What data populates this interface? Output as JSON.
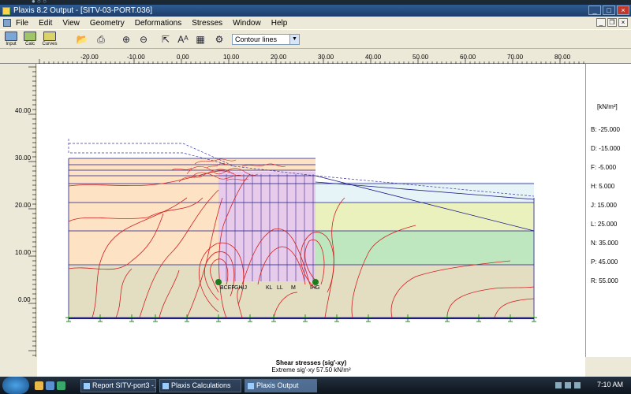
{
  "window": {
    "title": "Plaxis 8.2 Output - [SITV-03-PORT.036]"
  },
  "menu": [
    "File",
    "Edit",
    "View",
    "Geometry",
    "Deformations",
    "Stresses",
    "Window",
    "Help"
  ],
  "toolbar": {
    "input_label": "Input",
    "calc_label": "Calc",
    "curves_label": "Curves",
    "view_mode": "Contour lines"
  },
  "ruler": {
    "x_ticks": [
      "-20.00",
      "-10.00",
      "0.00",
      "10.00",
      "20.00",
      "30.00",
      "40.00",
      "50.00",
      "60.00",
      "70.00",
      "80.00"
    ],
    "y_ticks": [
      "40.00",
      "30.00",
      "20.00",
      "10.00",
      "0.00"
    ]
  },
  "legend": {
    "unit": "[kN/m²]",
    "entries": [
      {
        "key": "B",
        "value": "-25.000"
      },
      {
        "key": "D",
        "value": "-15.000"
      },
      {
        "key": "F",
        "value": "-5.000"
      },
      {
        "key": "H",
        "value": "5.000"
      },
      {
        "key": "J",
        "value": "15.000"
      },
      {
        "key": "L",
        "value": "25.000"
      },
      {
        "key": "N",
        "value": "35.000"
      },
      {
        "key": "P",
        "value": "45.000"
      },
      {
        "key": "R",
        "value": "55.000"
      }
    ]
  },
  "contour_labels": [
    "BCEF",
    "GHIJ",
    "KL",
    "LL",
    "M",
    "IHG"
  ],
  "caption": {
    "title": "Shear stresses (sig'-xy)",
    "subtitle": "Extreme sig'-xy 57.50 kN/m²"
  },
  "taskbar": {
    "tasks": [
      "Report SITV-port3 -...",
      "Plaxis Calculations",
      "Plaxis Output"
    ],
    "clock": "7:10 AM"
  },
  "colors": {
    "contour": "#d42020",
    "mesh_line": "#1a1a8a",
    "layer_top": "#fde2c4",
    "layer_mid": "#e8f0b8",
    "layer_green": "#bfe7bf",
    "layer_bottom": "#e3ddc1",
    "structure": "#e8c7ea"
  }
}
